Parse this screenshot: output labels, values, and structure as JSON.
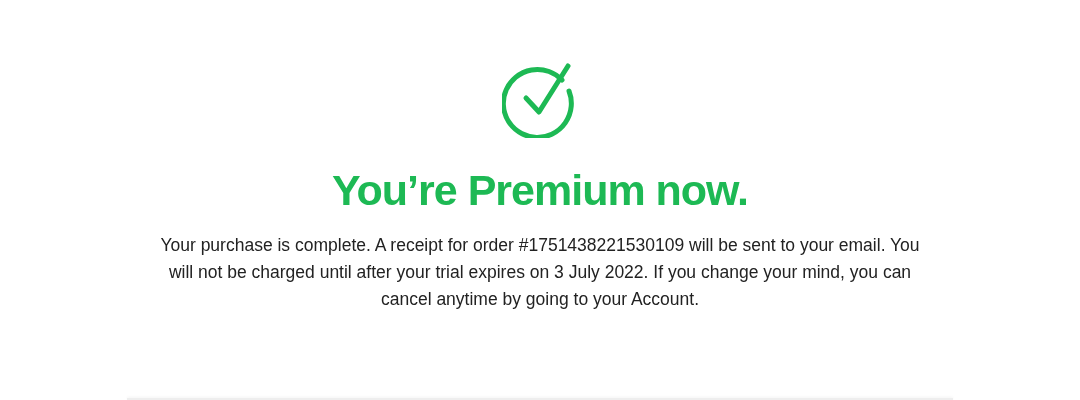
{
  "heading": "You’re Premium now.",
  "message": "Your purchase is complete. A receipt for order #1751438221530109 will be sent to your email. You will not be charged until after your trial expires on 3 July 2022. If you change your mind, you can cancel anytime by going to your Account."
}
